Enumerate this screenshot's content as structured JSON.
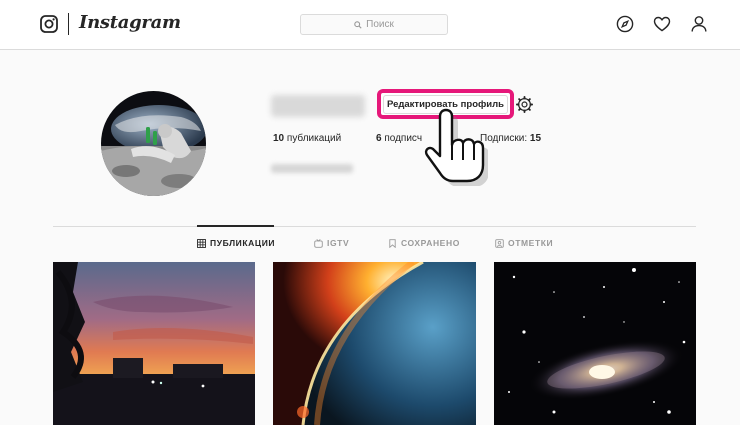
{
  "header": {
    "logo_text": "Instagram",
    "search_placeholder": "Поиск",
    "icons": [
      "instagram-glyph-icon",
      "explore-compass-icon",
      "heart-icon",
      "profile-icon"
    ]
  },
  "profile": {
    "edit_button_label": "Редактировать профиль",
    "highlight_color": "#e6187a",
    "stats": {
      "posts_count": "10",
      "posts_label": "публикаций",
      "followers_count": "6",
      "followers_label": "подписч",
      "following_label": "Подписки:",
      "following_count": "15"
    }
  },
  "tabs": [
    {
      "label": "ПУБЛИКАЦИИ",
      "icon": "grid-icon",
      "active": true
    },
    {
      "label": "IGTV",
      "icon": "tv-icon",
      "active": false
    },
    {
      "label": "СОХРАНЕНО",
      "icon": "bookmark-icon",
      "active": false
    },
    {
      "label": "ОТМЕТКИ",
      "icon": "tag-portrait-icon",
      "active": false
    }
  ],
  "posts": [
    {
      "subject": "sunset-photo"
    },
    {
      "subject": "planet-photo"
    },
    {
      "subject": "galaxy-photo"
    }
  ]
}
